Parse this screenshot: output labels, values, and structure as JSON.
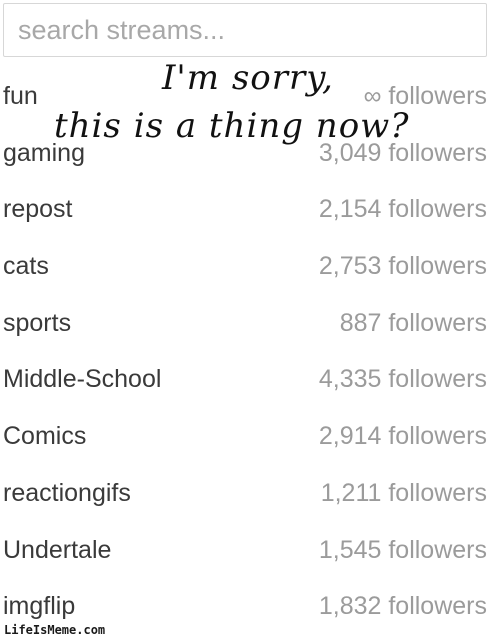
{
  "search": {
    "placeholder": "search streams...",
    "value": ""
  },
  "streams": [
    {
      "name": "fun",
      "followers": "∞ followers"
    },
    {
      "name": "gaming",
      "followers": "3,049 followers"
    },
    {
      "name": "repost",
      "followers": "2,154 followers"
    },
    {
      "name": "cats",
      "followers": "2,753 followers"
    },
    {
      "name": "sports",
      "followers": "887 followers"
    },
    {
      "name": "Middle-School",
      "followers": "4,335 followers"
    },
    {
      "name": "Comics",
      "followers": "2,914 followers"
    },
    {
      "name": "reactiongifs",
      "followers": "1,211 followers"
    },
    {
      "name": "Undertale",
      "followers": "1,545 followers"
    },
    {
      "name": "imgflip",
      "followers": "1,832 followers"
    }
  ],
  "caption": {
    "line1": "I'm sorry,",
    "line2": "this is a thing now?"
  },
  "watermark": "LifeIsMeme.com"
}
